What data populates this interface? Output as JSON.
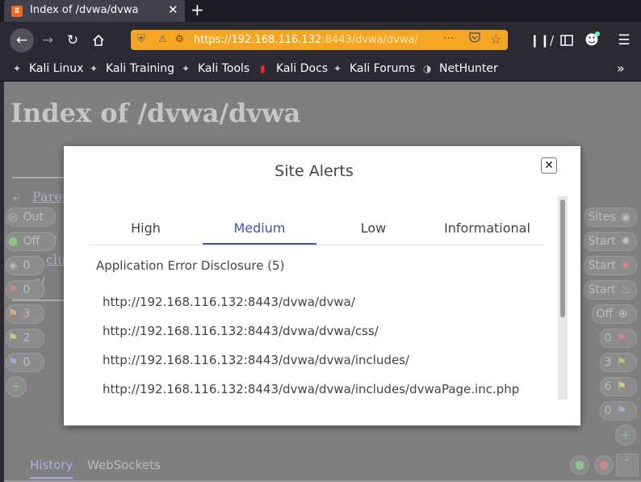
{
  "browser": {
    "tab_title": "Index of /dvwa/dvwa",
    "tab_favicon": "ʬ",
    "close_glyph": "✕",
    "new_tab_glyph": "+",
    "url_host": "https://192.168.116.132",
    "url_path": ":8443/dvwa/dvwa/",
    "url_more_glyph": "···",
    "icons": {
      "back": "back-arrow-icon",
      "forward": "forward-arrow-icon",
      "reload": "reload-icon",
      "home": "home-icon",
      "shield": "shield-icon",
      "lock": "lock-warning-icon",
      "robot": "robot-icon",
      "pocket": "pocket-icon",
      "star": "star-icon",
      "library": "library-icon",
      "sidebar": "sidebar-icon",
      "account": "account-icon",
      "menu": "hamburger-menu-icon"
    },
    "accent_color": "#f5a623"
  },
  "bookmarks": [
    {
      "label": "Kali Linux"
    },
    {
      "label": "Kali Training"
    },
    {
      "label": "Kali Tools"
    },
    {
      "label": "Kali Docs"
    },
    {
      "label": "Kali Forums"
    },
    {
      "label": "NetHunter"
    }
  ],
  "page": {
    "heading": "Index of /dvwa/dvwa",
    "links": [
      "Parent",
      "g",
      "clu",
      "s/"
    ],
    "hud_left": [
      {
        "label": "Out",
        "icon": "target-icon"
      },
      {
        "label": "Off",
        "icon": "toggle-icon"
      },
      {
        "label": "0",
        "icon": "lightbulb-icon"
      },
      {
        "label": "0",
        "icon": "red-flag-icon"
      },
      {
        "label": "3",
        "icon": "orange-flag-icon"
      },
      {
        "label": "2",
        "icon": "yellow-flag-icon"
      },
      {
        "label": "0",
        "icon": "blue-flag-icon"
      }
    ],
    "hud_add": "+",
    "hud_right": [
      {
        "label": "Sites",
        "icon": "globe-icon"
      },
      {
        "label": "Start",
        "icon": "spider-icon"
      },
      {
        "label": "Start",
        "icon": "ajax-spider-icon"
      },
      {
        "label": "Start",
        "icon": "fire-icon"
      },
      {
        "label": "Off",
        "icon": "crosshair-icon"
      },
      {
        "label": "0",
        "icon": "red-flag-icon"
      },
      {
        "label": "3",
        "icon": "orange-flag-icon"
      },
      {
        "label": "6",
        "icon": "yellow-flag-icon"
      },
      {
        "label": "0",
        "icon": "blue-flag-icon"
      }
    ],
    "footer_tabs": [
      "History",
      "WebSockets"
    ]
  },
  "modal": {
    "title": "Site Alerts",
    "close_glyph": "✕",
    "tabs": [
      "High",
      "Medium",
      "Low",
      "Informational"
    ],
    "active_tab": "Medium",
    "active_color": "#4152b2",
    "alert_group": "Application Error Disclosure (5)",
    "urls": [
      "http://192.168.116.132:8443/dvwa/dvwa/",
      "http://192.168.116.132:8443/dvwa/dvwa/css/",
      "http://192.168.116.132:8443/dvwa/dvwa/includes/",
      "http://192.168.116.132:8443/dvwa/dvwa/includes/dvwaPage.inc.php"
    ]
  }
}
